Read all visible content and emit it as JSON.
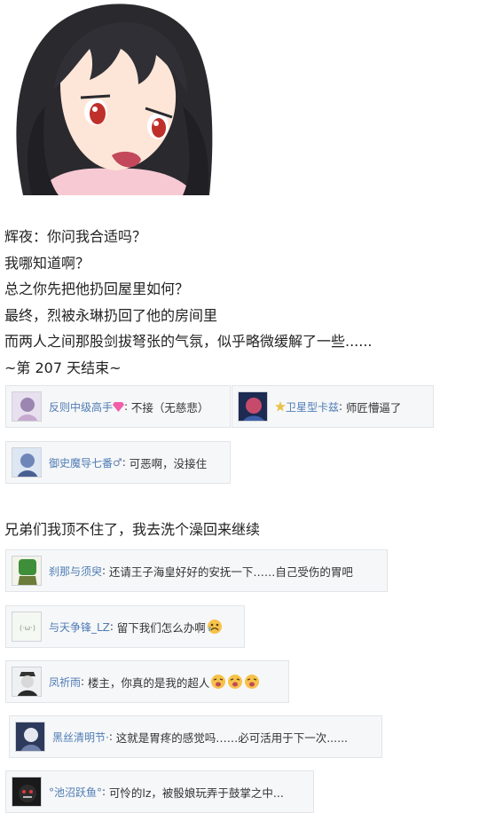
{
  "post1": {
    "lines": [
      "辉夜：你问我合适吗？",
      "我哪知道啊？",
      "总之你先把他扔回屋里如何？",
      "最终，烈被永琳扔回了他的房间里",
      "而两人之间那股剑拔弩张的气氛，似乎略微缓解了一些......",
      "~第 207 天结束~"
    ]
  },
  "comments1": [
    {
      "user": "反则中级高手",
      "text": "不接（无慈悲）",
      "icon": "diamond-badge-icon"
    },
    {
      "user": "卫星型卡兹",
      "text": "师匠懵逼了",
      "icon": "star-badge-icon"
    },
    {
      "user": "御史魔导七番",
      "text": "可恶啊，没接住",
      "icon": "male-symbol-icon"
    }
  ],
  "post2": {
    "text": "兄弟们我顶不住了，我去洗个澡回来继续"
  },
  "comments2": [
    {
      "user": "刹那与须臾",
      "text": "还请王子海皇好好的安抚一下……自己受伤的胃吧"
    },
    {
      "user": "与天争锋_LZ",
      "text": "留下我们怎么办啊",
      "icon": "crying-face-emoji-icon"
    },
    {
      "user": "凤祈雨",
      "text": "楼主，你真的是我的超人",
      "icon": "cheering-face-emoji-icon"
    },
    {
      "user": "黑丝清明节·",
      "text": "这就是胃疼的感觉吗……必可活用于下一次......"
    },
    {
      "user": "°池沼跃鱼°",
      "text": "可怜的lz，被骰娘玩弄于鼓掌之中..."
    }
  ],
  "colors": {
    "username": "#4f7cb6",
    "comment_bg": "#f6f7f8",
    "comment_border": "#e2e4e8",
    "hair": "#2a2a2e",
    "skin": "#fde6d8",
    "eye": "#c0302a"
  }
}
